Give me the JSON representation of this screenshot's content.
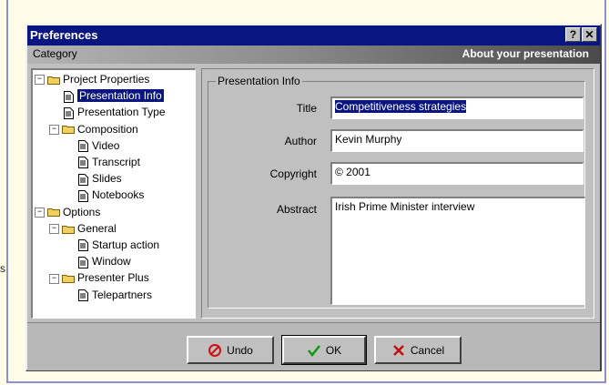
{
  "window": {
    "title": "Preferences",
    "help_glyph": "?",
    "close_glyph": "✕"
  },
  "header": {
    "category_label": "Category",
    "about_label": "About your presentation"
  },
  "stray_text": "s",
  "tree": {
    "items": [
      {
        "label": "Project Properties",
        "icon": "folder-icon",
        "expander": "−"
      },
      {
        "label": "Presentation Info",
        "icon": "document-icon",
        "selected": true
      },
      {
        "label": "Presentation Type",
        "icon": "document-icon"
      },
      {
        "label": "Composition",
        "icon": "folder-icon",
        "expander": "−"
      },
      {
        "label": "Video",
        "icon": "document-icon"
      },
      {
        "label": "Transcript",
        "icon": "document-icon"
      },
      {
        "label": "Slides",
        "icon": "document-icon"
      },
      {
        "label": "Notebooks",
        "icon": "document-icon"
      },
      {
        "label": "Options",
        "icon": "folder-icon",
        "expander": "−"
      },
      {
        "label": "General",
        "icon": "folder-icon",
        "expander": "−"
      },
      {
        "label": "Startup action",
        "icon": "document-icon"
      },
      {
        "label": "Window",
        "icon": "document-icon"
      },
      {
        "label": "Presenter Plus",
        "icon": "folder-icon",
        "expander": "−"
      },
      {
        "label": "Telepartners",
        "icon": "document-icon"
      }
    ]
  },
  "presentation_info": {
    "group_label": "Presentation Info",
    "title_label": "Title",
    "title_value": "Competitiveness strategies",
    "author_label": "Author",
    "author_value": "Kevin Murphy",
    "copyright_label": "Copyright",
    "copyright_value": "© 2001",
    "abstract_label": "Abstract",
    "abstract_value": "Irish Prime Minister interview"
  },
  "buttons": {
    "undo_label": "Undo",
    "ok_label": "OK",
    "cancel_label": "Cancel"
  },
  "colors": {
    "titlebar": "#0a1680",
    "selection": "#0a1680",
    "dialog_face": "#c0c0c0"
  }
}
